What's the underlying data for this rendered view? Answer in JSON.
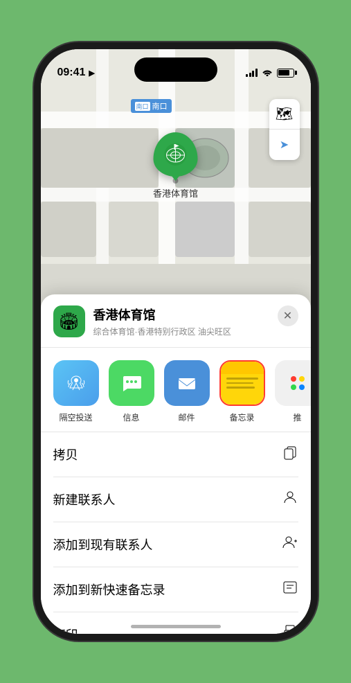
{
  "status_bar": {
    "time": "09:41",
    "location_arrow": "▶"
  },
  "map": {
    "label_nankou": "南口",
    "stadium_name": "香港体育馆",
    "controls": [
      {
        "icon": "🗺",
        "name": "map-type"
      },
      {
        "icon": "➤",
        "name": "location"
      }
    ]
  },
  "location_card": {
    "name": "香港体育馆",
    "subtitle": "综合体育馆·香港特别行政区 油尖旺区",
    "icon": "🏟"
  },
  "share_items": [
    {
      "id": "airdrop",
      "label": "隔空投送",
      "type": "airdrop"
    },
    {
      "id": "messages",
      "label": "信息",
      "type": "messages"
    },
    {
      "id": "mail",
      "label": "邮件",
      "type": "mail"
    },
    {
      "id": "notes",
      "label": "备忘录",
      "type": "notes",
      "selected": true
    },
    {
      "id": "more",
      "label": "推",
      "type": "more"
    }
  ],
  "action_items": [
    {
      "label": "拷贝",
      "icon": "copy"
    },
    {
      "label": "新建联系人",
      "icon": "person"
    },
    {
      "label": "添加到现有联系人",
      "icon": "person-add"
    },
    {
      "label": "添加到新快速备忘录",
      "icon": "note"
    },
    {
      "label": "打印",
      "icon": "print"
    }
  ]
}
